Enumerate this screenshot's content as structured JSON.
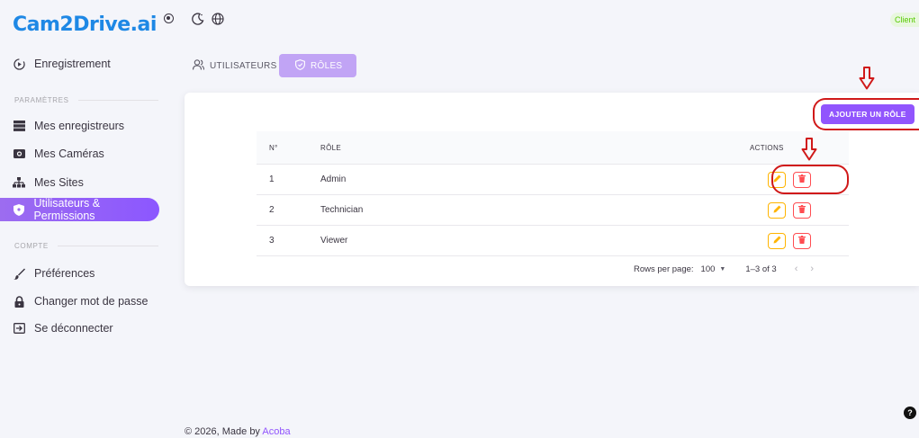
{
  "brand": {
    "name": "Cam2Drive.ai"
  },
  "sidebar": {
    "recording": "Enregistrement",
    "section_params": "PARAMÈTRES",
    "items_params": [
      {
        "label": "Mes enregistreurs",
        "icon": "server-icon"
      },
      {
        "label": "Mes Caméras",
        "icon": "camera-icon"
      },
      {
        "label": "Mes Sites",
        "icon": "sitemap-icon"
      },
      {
        "label": "Utilisateurs & Permissions",
        "icon": "shield-icon",
        "active": true
      }
    ],
    "section_account": "COMPTE",
    "items_account": [
      {
        "label": "Préférences",
        "icon": "brush-icon"
      },
      {
        "label": "Changer mot de passe",
        "icon": "lock-icon"
      },
      {
        "label": "Se déconnecter",
        "icon": "logout-icon"
      }
    ]
  },
  "topbar": {
    "client_label": "Client"
  },
  "tabs": [
    {
      "label": "UTILISATEURS",
      "active": false
    },
    {
      "label": "RÔLES",
      "active": true
    }
  ],
  "add_button": "AJOUTER UN RÔLE",
  "table": {
    "headers": {
      "number": "N°",
      "role": "RÔLE",
      "actions": "ACTIONS"
    },
    "rows": [
      {
        "number": "1",
        "role": "Admin"
      },
      {
        "number": "2",
        "role": "Technician"
      },
      {
        "number": "3",
        "role": "Viewer"
      }
    ]
  },
  "pagination": {
    "rows_per_page_label": "Rows per page:",
    "rows_per_page_value": "100",
    "range": "1–3 of 3"
  },
  "footer": {
    "prefix": "© 2026, Made by ",
    "brand": "Acoba"
  },
  "colors": {
    "accent": "#9155fd",
    "edit": "#ffb400",
    "delete": "#ff4c51",
    "annotation": "#d01919"
  }
}
